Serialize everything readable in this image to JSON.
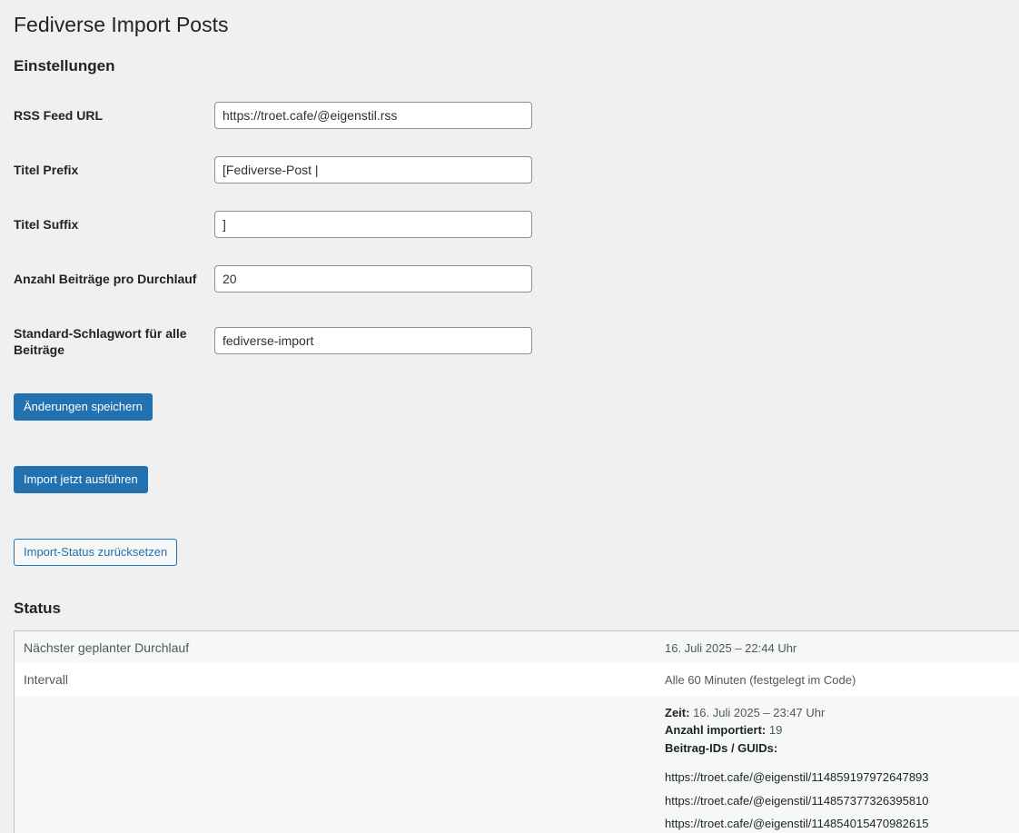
{
  "page": {
    "title": "Fediverse Import Posts"
  },
  "settings": {
    "section_title": "Einstellungen",
    "fields": [
      {
        "label": "RSS Feed URL",
        "value": "https://troet.cafe/@eigenstil.rss"
      },
      {
        "label": "Titel Prefix",
        "value": "[Fediverse-Post |"
      },
      {
        "label": "Titel Suffix",
        "value": "]"
      },
      {
        "label": "Anzahl Beiträge pro Durchlauf",
        "value": "20"
      },
      {
        "label": "Standard-Schlagwort für alle Beiträge",
        "value": "fediverse-import"
      }
    ],
    "save_label": "Änderungen speichern"
  },
  "actions": {
    "run_import_label": "Import jetzt ausführen",
    "reset_status_label": "Import-Status zurücksetzen"
  },
  "status": {
    "section_title": "Status",
    "rows": [
      {
        "key": "Nächster geplanter Durchlauf",
        "value": "16. Juli 2025 – 22:44 Uhr"
      },
      {
        "key": "Intervall",
        "value": "Alle 60 Minuten (festgelegt im Code)"
      }
    ],
    "last_run": {
      "time_label": "Zeit:",
      "time_value": "16. Juli 2025 – 23:47 Uhr",
      "count_label": "Anzahl importiert:",
      "count_value": "19",
      "guids_label": "Beitrag-IDs / GUIDs:",
      "guids": [
        "https://troet.cafe/@eigenstil/114859197972647893",
        "https://troet.cafe/@eigenstil/114857377326395810",
        "https://troet.cafe/@eigenstil/114854015470982615"
      ]
    }
  }
}
